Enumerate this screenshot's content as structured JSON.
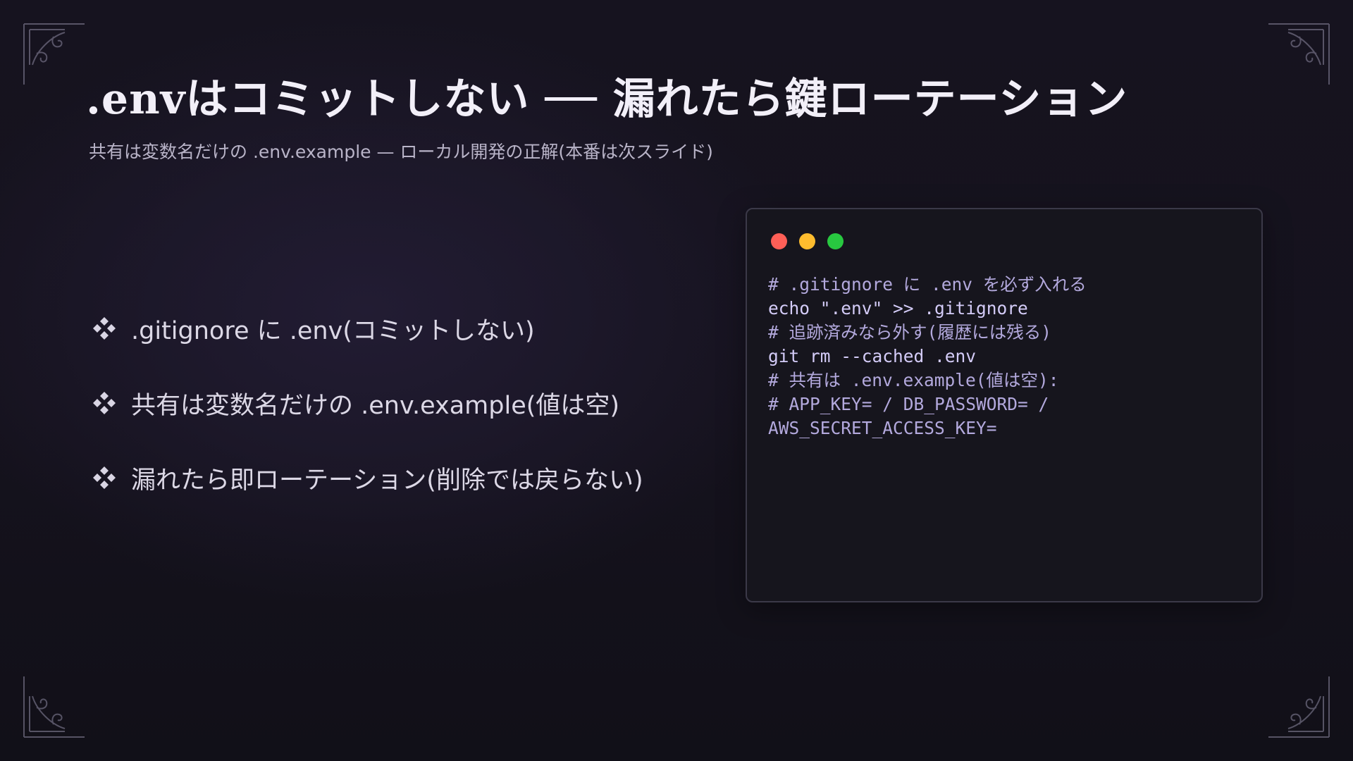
{
  "slide": {
    "title": ".envはコミットしない ── 漏れたら鍵ローテーション",
    "subtitle": "共有は変数名だけの .env.example — ローカル開発の正解(本番は次スライド)"
  },
  "bullets": [
    {
      "icon": "diamond-bullet-icon",
      "text": ".gitignore に .env(コミットしない)"
    },
    {
      "icon": "diamond-bullet-icon",
      "text": "共有は変数名だけの .env.example(値は空)"
    },
    {
      "icon": "diamond-bullet-icon",
      "text": "漏れたら即ローテーション(削除では戻らない)"
    }
  ],
  "terminal": {
    "window_controls": [
      {
        "name": "close",
        "color": "#ff5f57"
      },
      {
        "name": "minimize",
        "color": "#febc2e"
      },
      {
        "name": "maximize",
        "color": "#28c840"
      }
    ],
    "lines": [
      {
        "kind": "comment",
        "text": "# .gitignore に .env を必ず入れる"
      },
      {
        "kind": "cmd",
        "text": "echo \".env\" >> .gitignore"
      },
      {
        "kind": "comment",
        "text": "# 追跡済みなら外す(履歴には残る)"
      },
      {
        "kind": "cmd",
        "text": "git rm --cached .env"
      },
      {
        "kind": "comment",
        "text": "# 共有は .env.example(値は空):"
      },
      {
        "kind": "comment",
        "text": "# APP_KEY= / DB_PASSWORD= /"
      },
      {
        "kind": "comment",
        "text": "AWS_SECRET_ACCESS_KEY="
      }
    ]
  },
  "colors": {
    "background": "#14121d",
    "title": "#f2eff8",
    "code": "#c9c0f0",
    "terminal_bg": "#16151d"
  }
}
